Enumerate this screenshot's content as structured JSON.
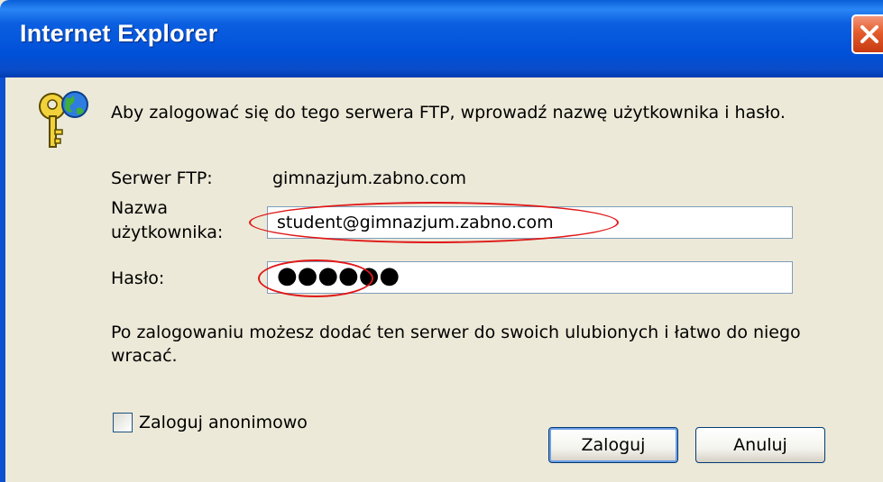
{
  "window": {
    "title": "Internet Explorer"
  },
  "dialog": {
    "message": "Aby zalogować się do tego serwera FTP, wprowadź nazwę użytkownika i hasło.",
    "server_label": "Serwer FTP:",
    "server_value": "gimnazjum.zabno.com",
    "username_label_line1": "Nazwa",
    "username_label_line2": "użytkownika:",
    "username_value": "student@gimnazjum.zabno.com",
    "password_label": "Hasło:",
    "password_dots": "●●●●●●",
    "info_line1": "Po zalogowaniu możesz dodać ten serwer do swoich ulubionych i łatwo do niego",
    "info_line2": "wracać.",
    "anonymous_label": "Zaloguj anonimowo",
    "anonymous_checked": false,
    "login_button": "Zaloguj",
    "cancel_button": "Anuluj"
  },
  "icons": {
    "close": "close-icon",
    "key": "key-globe-icon"
  },
  "colors": {
    "titlebar": "#0a50d8",
    "client_bg": "#ece9d8",
    "annotation": "#e01818",
    "close_button": "#e45c2c"
  }
}
